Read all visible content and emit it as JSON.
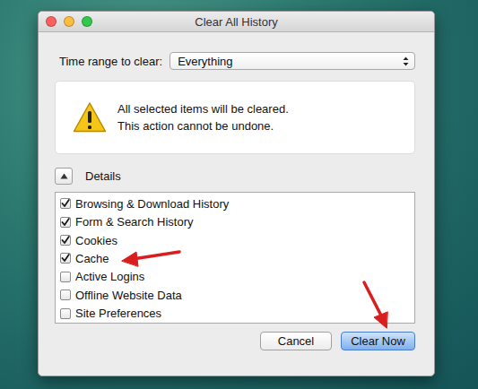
{
  "window": {
    "title": "Clear All History"
  },
  "time_range": {
    "label": "Time range to clear:",
    "value": "Everything"
  },
  "warning": {
    "lines": [
      "All selected items will be cleared.",
      "This action cannot be undone."
    ]
  },
  "details": {
    "label": "Details",
    "expanded": true
  },
  "items": [
    {
      "label": "Browsing & Download History",
      "checked": true
    },
    {
      "label": "Form & Search History",
      "checked": true
    },
    {
      "label": "Cookies",
      "checked": true
    },
    {
      "label": "Cache",
      "checked": true
    },
    {
      "label": "Active Logins",
      "checked": false
    },
    {
      "label": "Offline Website Data",
      "checked": false
    },
    {
      "label": "Site Preferences",
      "checked": false
    }
  ],
  "buttons": [
    {
      "label": "Cancel",
      "default": false
    },
    {
      "label": "Clear Now",
      "default": true
    }
  ]
}
